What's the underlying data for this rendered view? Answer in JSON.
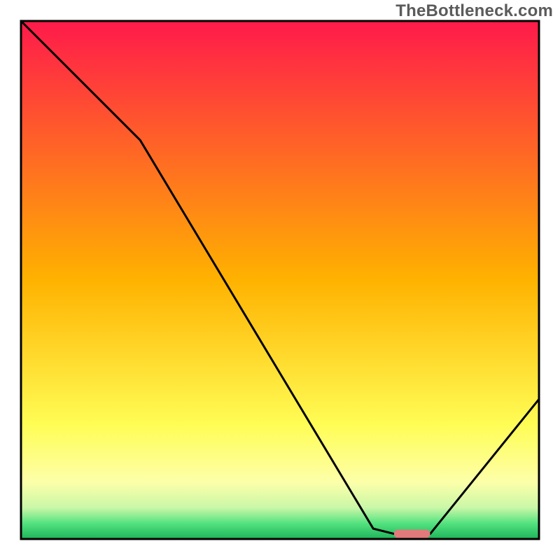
{
  "watermark": "TheBottleneck.com",
  "chart_data": {
    "type": "line",
    "title": "",
    "xlabel": "",
    "ylabel": "",
    "xlim": [
      0,
      100
    ],
    "ylim": [
      0,
      100
    ],
    "grid": false,
    "legend": "none",
    "series": [
      {
        "name": "bottleneck-curve",
        "x": [
          0,
          23,
          68,
          72,
          79,
          100
        ],
        "y": [
          100,
          77,
          2,
          1,
          1,
          27
        ]
      }
    ],
    "marker": {
      "name": "optimal-range",
      "x_start": 72,
      "x_end": 79,
      "y": 1,
      "color": "#e2797b"
    },
    "background_gradient": {
      "stops": [
        {
          "offset": 0,
          "color": "#ff1a4b"
        },
        {
          "offset": 50,
          "color": "#ffb200"
        },
        {
          "offset": 78,
          "color": "#fffd55"
        },
        {
          "offset": 89,
          "color": "#fdffa9"
        },
        {
          "offset": 94,
          "color": "#c9f7a8"
        },
        {
          "offset": 97,
          "color": "#53e27f"
        },
        {
          "offset": 100,
          "color": "#1db45a"
        }
      ]
    },
    "annotations": []
  }
}
